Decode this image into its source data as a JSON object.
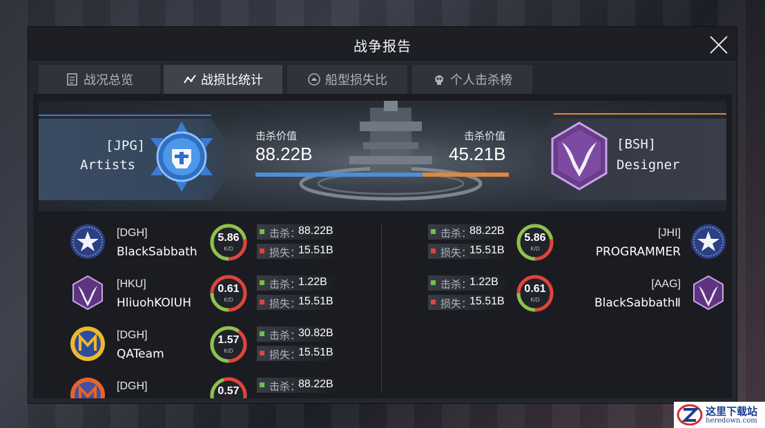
{
  "window": {
    "title": "战争报告"
  },
  "tabs": [
    {
      "label": "战况总览",
      "icon": "report-icon",
      "active": false
    },
    {
      "label": "战损比统计",
      "icon": "chart-line-icon",
      "active": true
    },
    {
      "label": "船型损失比",
      "icon": "ship-icon",
      "active": false
    },
    {
      "label": "个人击杀榜",
      "icon": "skull-icon",
      "active": false
    }
  ],
  "summary": {
    "left": {
      "tag": "[JPG]",
      "name": "Artists",
      "kill_label": "击杀价值",
      "kill_value": "88.22B",
      "color": "#4b8fd6"
    },
    "right": {
      "tag": "[BSH]",
      "name": "Designer",
      "kill_label": "击杀价值",
      "kill_value": "45.21B",
      "color": "#e0883a"
    },
    "left_share": 0.66
  },
  "players_left": [
    {
      "tag": "[DGH]",
      "name": "BlackSabbath",
      "kd": "5.86",
      "kd_ratio": 0.72,
      "kill": "88.22B",
      "loss": "15.51B",
      "emblem": "star-emblem-icon"
    },
    {
      "tag": "[HKU]",
      "name": "HliuohKOIUH",
      "kd": "0.61",
      "kd_ratio": 0.25,
      "kill": "1.22B",
      "loss": "15.51B",
      "emblem": "demon-emblem-icon"
    },
    {
      "tag": "[DGH]",
      "name": "QATeam",
      "kd": "1.57",
      "kd_ratio": 0.6,
      "kill": "30.82B",
      "loss": "15.51B",
      "emblem": "gold-m-emblem-icon"
    },
    {
      "tag": "[DGH]",
      "name": "",
      "kd": "0.57",
      "kd_ratio": 0.45,
      "kill": "88.22B",
      "loss": "",
      "emblem": "orange-m-emblem-icon"
    }
  ],
  "players_right": [
    {
      "tag": "[JHI]",
      "name": "PROGRAMMER",
      "kd": "5.86",
      "kd_ratio": 0.72,
      "kill": "88.22B",
      "loss": "15.51B",
      "emblem": "star-emblem-icon"
    },
    {
      "tag": "[AAG]",
      "name": "BlackSabbathⅡ",
      "kd": "0.61",
      "kd_ratio": 0.25,
      "kill": "1.22B",
      "loss": "15.51B",
      "emblem": "demon-emblem-icon"
    }
  ],
  "labels": {
    "kill": "击杀：",
    "loss": "损失：",
    "kd": "K/D"
  },
  "colors": {
    "kill": "#6cc24a",
    "loss": "#e0443a",
    "kd_good": "#8bc34a",
    "kd_bad": "#e0443a"
  },
  "watermark": {
    "line1": "这里下载站",
    "line2": "heredown.com"
  }
}
